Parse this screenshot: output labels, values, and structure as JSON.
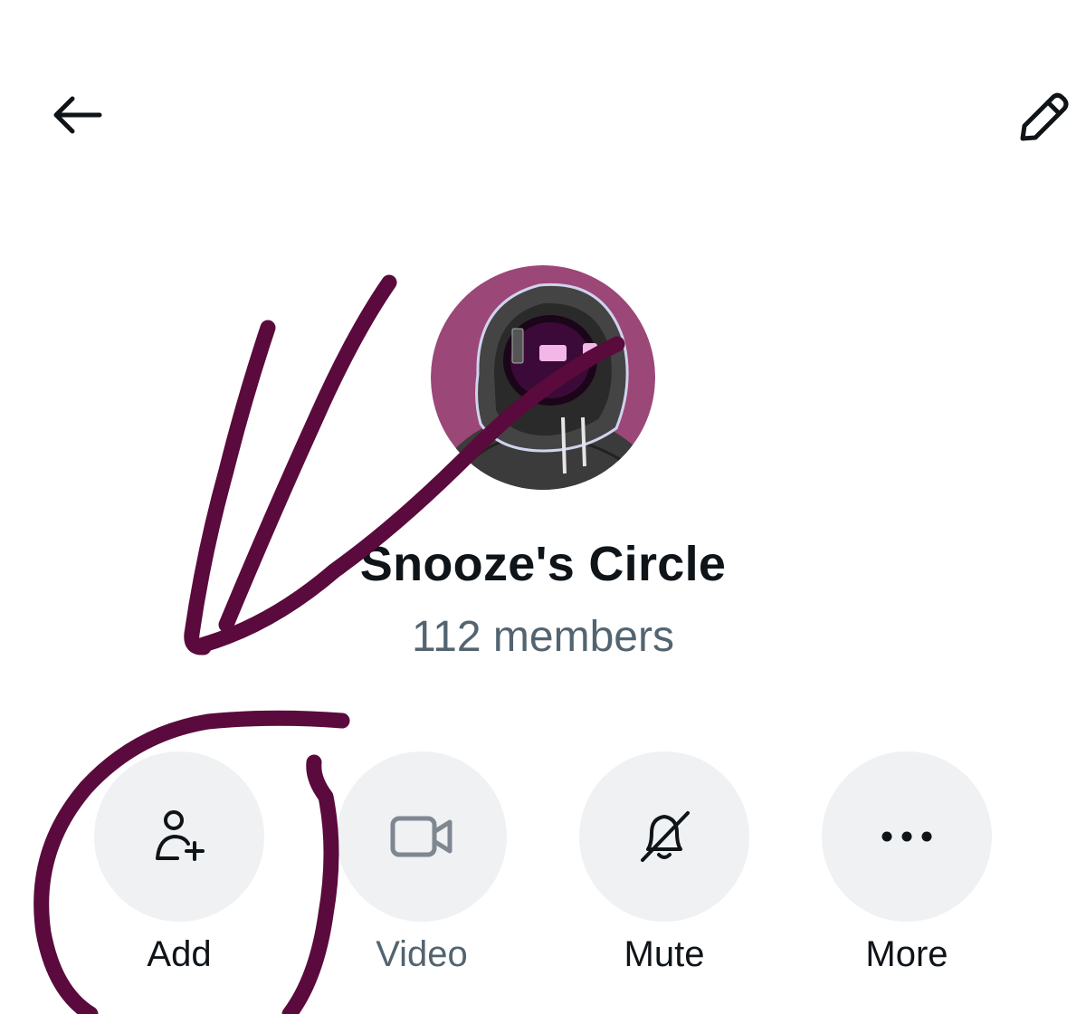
{
  "header": {
    "back_icon": "arrow-left-icon",
    "edit_icon": "pencil-icon"
  },
  "group": {
    "name": "Snooze's Circle",
    "members": "112 members",
    "avatar_bg": "#9b4778"
  },
  "actions": [
    {
      "label": "Add",
      "icon": "add-person-icon",
      "enabled": true
    },
    {
      "label": "Video",
      "icon": "video-camera-icon",
      "enabled": false
    },
    {
      "label": "Mute",
      "icon": "bell-off-icon",
      "enabled": true
    },
    {
      "label": "More",
      "icon": "more-dots-icon",
      "enabled": true
    }
  ],
  "colors": {
    "text_primary": "#0f1419",
    "text_secondary": "#536471",
    "button_bg": "#eff1f3",
    "annotation_ink": "#5a0a3c"
  }
}
